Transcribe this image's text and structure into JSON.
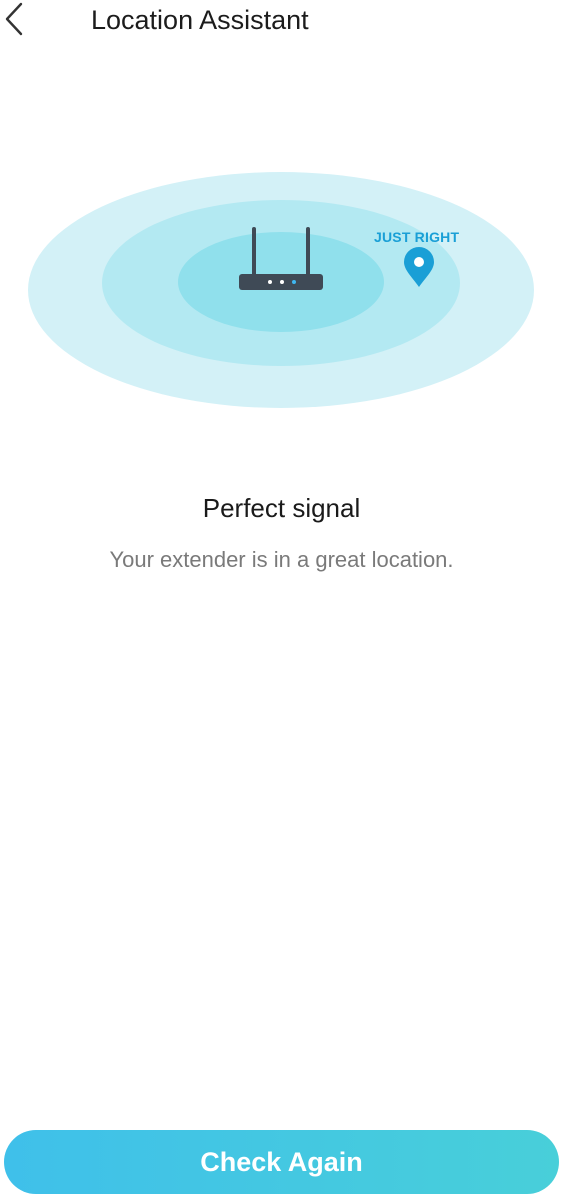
{
  "header": {
    "title": "Location Assistant",
    "back_icon": "chevron-left-icon"
  },
  "illustration": {
    "location_label": "JUST RIGHT",
    "device_icon": "router-icon",
    "marker_icon": "location-pin-icon",
    "colors": {
      "outer_ring": "#d3f1f7",
      "middle_ring": "#b3e9f2",
      "inner_ring": "#90e0ec",
      "accent": "#1a9fd6",
      "device": "#3f4a56"
    }
  },
  "status": {
    "title": "Perfect signal",
    "description": "Your extender is in a great location."
  },
  "actions": {
    "check_again_label": "Check Again"
  }
}
